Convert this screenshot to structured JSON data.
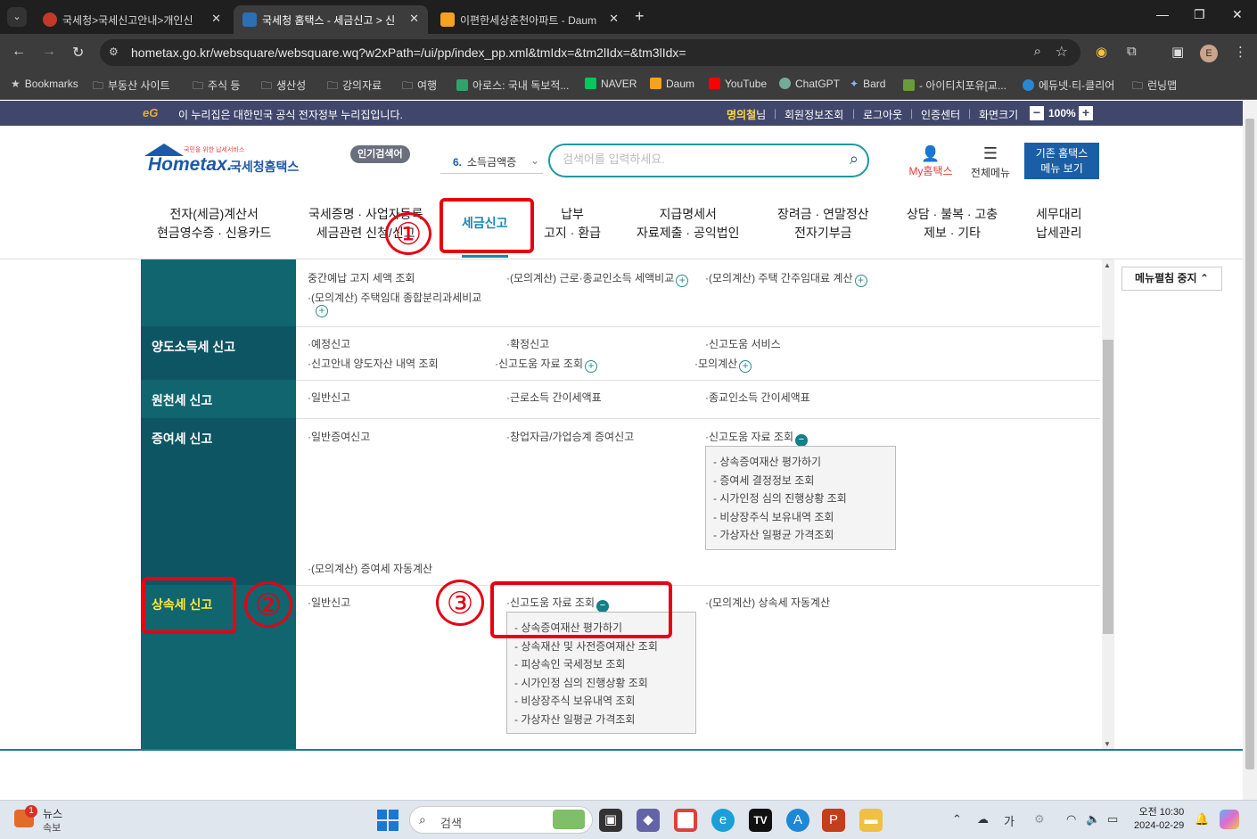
{
  "browser": {
    "tabs": [
      {
        "title": "국세청>국세신고안내>개인신",
        "active": false
      },
      {
        "title": "국세청 홈택스 - 세금신고 > 신",
        "active": true
      },
      {
        "title": "이편한세상춘천아파트 - Daum",
        "active": false
      }
    ],
    "url": "hometax.go.kr/websquare/websquare.wq?w2xPath=/ui/pp/index_pp.xml&tmIdx=&tm2lIdx=&tm3lIdx=",
    "profile_initial": "E",
    "bookmarks": [
      "Bookmarks",
      "부동산 사이트",
      "주식 등",
      "생산성",
      "강의자료",
      "여행",
      "아로스: 국내 독보적...",
      "NAVER",
      "Daum",
      "YouTube",
      "ChatGPT",
      "Bard",
      "- 아이티치포유[교...",
      "에듀넷·티-클리어",
      "런닝맵"
    ]
  },
  "gov_bar": {
    "notice": "이 누리집은 대한민국 공식 전자정부 누리집입니다.",
    "user_name": "명의철",
    "user_suffix": "님",
    "links": [
      "회원정보조회",
      "로그아웃",
      "인증센터",
      "화면크기"
    ],
    "zoom": "100%",
    "minus": "−",
    "plus": "+"
  },
  "header": {
    "logo_small": "국민을 위한 납세서비스",
    "logo_main": "Hometax.",
    "logo_ko": "국세청홈택스",
    "popular_label": "인기검색어",
    "popular_rank": "6.",
    "popular_term": "소득금액증",
    "search_placeholder": "검색어를 입력하세요.",
    "my_hometax": "My홈택스",
    "all_menu": "전체메뉴",
    "old_hometax_line1": "기존 홈택스",
    "old_hometax_line2": "메뉴 보기"
  },
  "gnb": [
    {
      "line1": "전자(세금)계산서",
      "line2": "현금영수증 · 신용카드"
    },
    {
      "line1": "국세증명 · 사업자등록",
      "line2": "세금관련 신청/신고"
    },
    {
      "line1": "세금신고",
      "line2": ""
    },
    {
      "line1": "납부",
      "line2": "고지 · 환급"
    },
    {
      "line1": "지급명세서",
      "line2": "자료제출 · 공익법인"
    },
    {
      "line1": "장려금 · 연말정산",
      "line2": "전자기부금"
    },
    {
      "line1": "상담 · 불복 · 고충",
      "line2": "제보 · 기타"
    },
    {
      "line1": "세무대리",
      "line2": "납세관리"
    }
  ],
  "sections": {
    "top": {
      "items": [
        "중간예납 고지 세액 조회",
        "(모의계산) 근로·종교인소득 세액비교",
        "(모의계산) 주택 간주임대료 계산",
        "(모의계산) 주택임대 종합분리과세비교"
      ]
    },
    "yangdo": {
      "title": "양도소득세 신고",
      "items": [
        "예정신고",
        "확정신고",
        "신고도움 서비스",
        "신고안내 양도자산 내역 조회",
        "신고도움 자료 조회",
        "모의계산"
      ]
    },
    "wonchun": {
      "title": "원천세 신고",
      "items": [
        "일반신고",
        "근로소득 간이세액표",
        "종교인소득 간이세액표"
      ]
    },
    "jeungyeo": {
      "title": "증여세 신고",
      "items": [
        "일반증여신고",
        "창업자금/가업승계 증여신고",
        "신고도움 자료 조회",
        "(모의계산) 증여세 자동계산"
      ],
      "sub": [
        "상속증여재산 평가하기",
        "증여세 결정정보 조회",
        "시가인정 심의 진행상황 조회",
        "비상장주식 보유내역 조회",
        "가상자산 일평균 가격조회"
      ]
    },
    "sangsok": {
      "title": "상속세 신고",
      "items": [
        "일반신고",
        "신고도움 자료 조회",
        "(모의계산) 상속세 자동계산"
      ],
      "sub": [
        "상속증여재산 평가하기",
        "상속재산 및 사전증여재산 조회",
        "피상속인 국세정보 조회",
        "시가인정 심의 진행상황 조회",
        "비상장주식 보유내역 조회",
        "가상자산 일평균 가격조회"
      ]
    }
  },
  "menu_pause": "메뉴펼침 중지",
  "annotations": [
    "①",
    "②",
    "③"
  ],
  "taskbar": {
    "news_title": "뉴스",
    "news_sub": "속보",
    "news_badge": "1",
    "search": "검색",
    "time": "오전 10:30",
    "date": "2024-02-29",
    "ime": "가"
  },
  "colors": {
    "teal": "#10656f",
    "accent": "#1a85b8",
    "annotation_red": "#e60012",
    "gov_bar": "#40476b"
  }
}
